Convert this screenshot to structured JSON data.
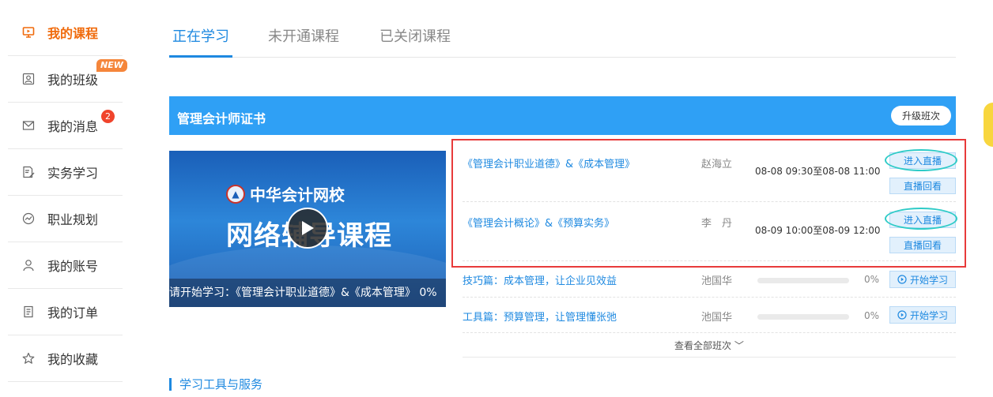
{
  "sidebar": {
    "items": [
      {
        "label": "我的课程",
        "icon": "play-screen-icon"
      },
      {
        "label": "我的班级",
        "icon": "class-icon"
      },
      {
        "label": "我的消息",
        "icon": "mail-icon"
      },
      {
        "label": "实务学习",
        "icon": "edit-doc-icon"
      },
      {
        "label": "职业规划",
        "icon": "trend-icon"
      },
      {
        "label": "我的账号",
        "icon": "user-icon"
      },
      {
        "label": "我的订单",
        "icon": "order-icon"
      },
      {
        "label": "我的收藏",
        "icon": "star-icon"
      }
    ],
    "new_badge": "NEW",
    "message_count": "2"
  },
  "tabs": [
    {
      "label": "正在学习"
    },
    {
      "label": "未开通课程"
    },
    {
      "label": "已关闭课程"
    }
  ],
  "course": {
    "title": "管理会计师证书",
    "upgrade_label": "升级班次",
    "thumb": {
      "logo_text": "中华会计网校",
      "big_text": "网络辅导课程",
      "caption": "请开始学习：《管理会计职业道德》&《成本管理》 0%"
    },
    "live_lessons": [
      {
        "title": "《管理会计职业道德》&《成本管理》",
        "teacher": "赵海立",
        "time": "08-08 09:30至08-08 11:00",
        "enter_label": "进入直播",
        "replay_label": "直播回看"
      },
      {
        "title": "《管理会计概论》&《预算实务》",
        "teacher": "李　丹",
        "time": "08-09 10:00至08-09 12:00",
        "enter_label": "进入直播",
        "replay_label": "直播回看"
      }
    ],
    "lessons": [
      {
        "title": "技巧篇：成本管理，让企业见效益",
        "teacher": "池国华",
        "progress": 0,
        "progress_label": "0%",
        "start_label": "开始学习"
      },
      {
        "title": "工具篇：预算管理，让管理懂张弛",
        "teacher": "池国华",
        "progress": 0,
        "progress_label": "0%",
        "start_label": "开始学习"
      }
    ],
    "view_all_label": "查看全部班次 ﹀"
  },
  "section": {
    "title": "学习工具与服务"
  },
  "colors": {
    "accent": "#1e89e0",
    "active_orange": "#f06a0b",
    "banner_blue": "#2fa0f5",
    "highlight_red": "#e83a3a",
    "ring_teal": "#2ecbc7"
  }
}
